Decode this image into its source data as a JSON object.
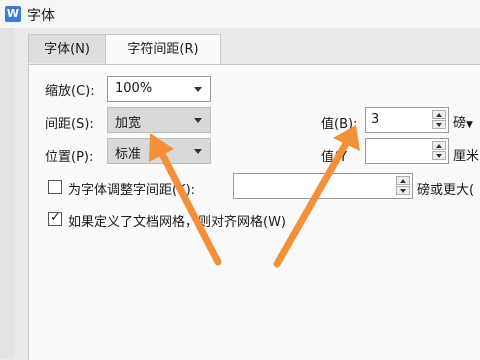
{
  "window": {
    "title": "字体",
    "app_icon": "W"
  },
  "tabs": [
    {
      "label": "字体(N)"
    },
    {
      "label": "字符间距(R)"
    }
  ],
  "scale": {
    "label": "缩放(C):",
    "value": "100%"
  },
  "spacing": {
    "label": "间距(S):",
    "value": "加宽",
    "amount_label": "值(B):",
    "amount_value": "3",
    "unit": "磅"
  },
  "position": {
    "label": "位置(P):",
    "value": "标准",
    "amount_label": "值(Y",
    "amount_value": "",
    "unit": "厘米"
  },
  "kerning": {
    "label": "为字体调整字间距(K):",
    "value": "",
    "suffix": "磅或更大("
  },
  "grid": {
    "label": "如果定义了文档网格，则对齐网格(W)",
    "checked": true
  },
  "colors": {
    "arrow": "#f4903a",
    "accent": "#3d7bdc"
  }
}
